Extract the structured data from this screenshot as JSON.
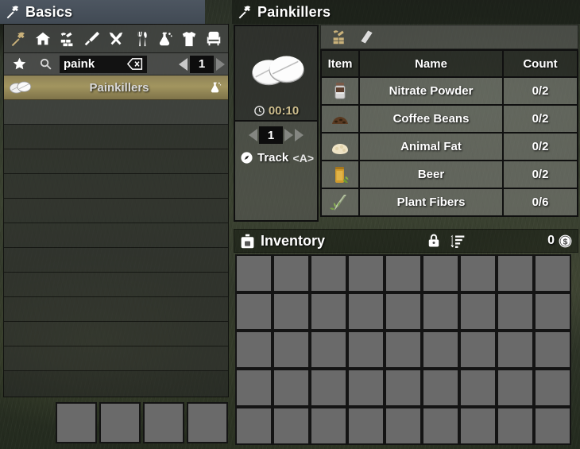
{
  "left": {
    "title": "Basics",
    "title_icon": "hammer-icon",
    "categories": [
      {
        "name": "hammer-icon",
        "label": "Basics",
        "selected": true
      },
      {
        "name": "house-icon",
        "label": "Building",
        "selected": false
      },
      {
        "name": "blocks-icon",
        "label": "Blocks",
        "selected": false
      },
      {
        "name": "knife-icon",
        "label": "Weapons",
        "selected": false
      },
      {
        "name": "tools-icon",
        "label": "Tools",
        "selected": false
      },
      {
        "name": "fork-icon",
        "label": "Food",
        "selected": false
      },
      {
        "name": "chemistry-icon",
        "label": "Medical",
        "selected": false
      },
      {
        "name": "shirt-icon",
        "label": "Clothing",
        "selected": false
      },
      {
        "name": "chair-icon",
        "label": "Decor",
        "selected": false
      }
    ],
    "search": {
      "value": "paink",
      "placeholder": "",
      "star_icon": "star-icon",
      "magnifier_icon": "search-icon",
      "clear_icon": "backspace-icon"
    },
    "pager": {
      "page": "1",
      "prev_icon": "triangle-left-icon",
      "next_icon": "triangle-right-icon"
    },
    "recipes": [
      {
        "name": "Painkillers",
        "selected": true,
        "item_icon": "pills-icon",
        "tool_icon": "chemistry-station-icon"
      }
    ],
    "empty_row_count": 11,
    "hotbar_slot_count": 4
  },
  "right": {
    "title": "Painkillers",
    "title_icon": "hammer-icon",
    "tabs": [
      {
        "name": "craft-tab",
        "icon": "workbench-icon",
        "selected": true
      },
      {
        "name": "book-tab",
        "icon": "book-icon",
        "selected": false
      }
    ],
    "product": {
      "icon": "pills-icon",
      "craft_time": "00:10",
      "time_icon": "clock-icon"
    },
    "craft_controls": {
      "quantity": "1",
      "dec_icon": "triangle-left-icon",
      "inc_icon": "triangle-right-icon",
      "inc_max_icon": "triangle-right-icon",
      "track_label": "Track",
      "track_key": "<A>",
      "track_icon": "compass-icon"
    },
    "ingredients": {
      "headers": [
        "Item",
        "Name",
        "Count"
      ],
      "rows": [
        {
          "icon": "nitrate-powder-icon",
          "name": "Nitrate Powder",
          "count": "0/2"
        },
        {
          "icon": "coffee-beans-icon",
          "name": "Coffee Beans",
          "count": "0/2"
        },
        {
          "icon": "animal-fat-icon",
          "name": "Animal Fat",
          "count": "0/2"
        },
        {
          "icon": "beer-icon",
          "name": "Beer",
          "count": "0/2"
        },
        {
          "icon": "plant-fibers-icon",
          "name": "Plant Fibers",
          "count": "0/6"
        }
      ]
    }
  },
  "inventory": {
    "title": "Inventory",
    "backpack_icon": "backpack-icon",
    "lock_icon": "lock-icon",
    "sort_icon": "sort-icon",
    "money_value": "0",
    "money_icon": "dukes-coin-icon",
    "columns": 9,
    "rows": 5,
    "slot_count": 45
  },
  "colors": {
    "accent_gold": "#a2955f",
    "panel_gray": "#7a7c78",
    "dark_border": "#101010",
    "title_blue_gray": "#4d5661",
    "time_text": "#cdbd8d"
  }
}
